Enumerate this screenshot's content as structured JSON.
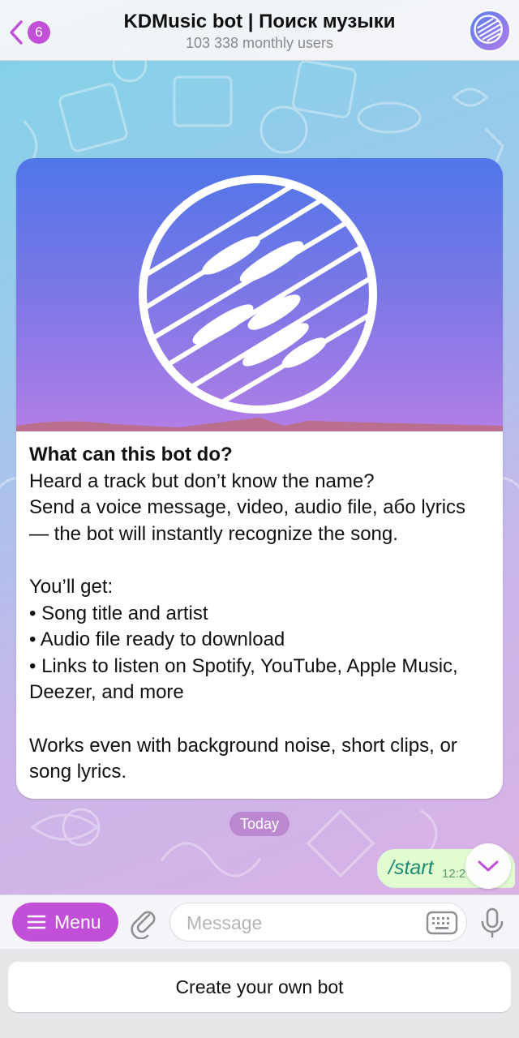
{
  "header": {
    "back_badge": "6",
    "title": "KDMusic bot | Поиск музыки",
    "subtitle": "103 338 monthly users"
  },
  "card": {
    "heading": "What can this bot do?",
    "lines": [
      "Heard a track but don’t know the name?",
      "Send a voice message, video, audio file, або lyrics",
      "— the bot will instantly recognize the song.",
      "",
      "You’ll get:",
      "• Song title and artist",
      "• Audio file ready to download",
      "• Links to listen on Spotify, YouTube, Apple Music,",
      "Deezer, and more",
      "",
      "Works even with background noise, short clips, or",
      "song lyrics."
    ]
  },
  "date_separator": "Today",
  "outgoing": {
    "text": "/start",
    "time": "12:2"
  },
  "input": {
    "menu_label": "Menu",
    "placeholder": "Message",
    "value": ""
  },
  "bottom": {
    "create_label": "Create your own bot"
  },
  "colors": {
    "accent": "#c24fd7",
    "outgoing_bubble": "#e1fcd0",
    "outgoing_text": "#1e8a72"
  }
}
